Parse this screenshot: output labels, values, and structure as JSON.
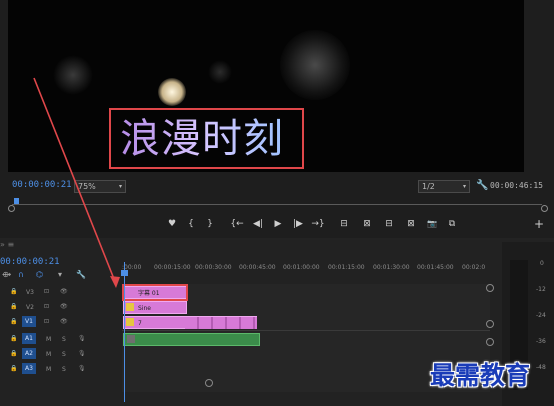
{
  "monitor": {
    "title_text": "浪漫时刻",
    "current_timecode": "00:00:00:21",
    "zoom": "75%",
    "resolution": "1/2",
    "duration": "00:00:46:15"
  },
  "controls": {
    "marker": "♥",
    "in": "{",
    "out": "}",
    "goto_in": "{←",
    "step_back": "◀|",
    "play": "▶",
    "step_fwd": "|▶",
    "goto_out": "→}",
    "lift": "⊟",
    "extract": "⊠",
    "camera": "📷",
    "add": "+"
  },
  "timeline": {
    "timecode": "00:00:00:21",
    "ruler": [
      ":00:00",
      "00:00:15:00",
      "00:00:30:00",
      "00:00:45:00",
      "00:01:00:00",
      "00:01:15:00",
      "00:01:30:00",
      "00:01:45:00",
      "00:02:0"
    ],
    "tracks": [
      {
        "id": "V3",
        "label": "V3"
      },
      {
        "id": "V2",
        "label": "V2"
      },
      {
        "id": "V1",
        "label": "V1"
      },
      {
        "id": "A1",
        "label": "A1",
        "m": "M",
        "s": "S"
      },
      {
        "id": "A2",
        "label": "A2",
        "m": "M",
        "s": "S"
      },
      {
        "id": "A3",
        "label": "A3",
        "m": "M",
        "s": "S"
      }
    ],
    "clips": {
      "v3": "字幕 01",
      "v2": "Sine",
      "v1": "7",
      "v1_sub": [
        "",
        ""
      ]
    },
    "meter_labels": [
      "0",
      "-12",
      "-24",
      "-36",
      "-48"
    ]
  },
  "watermark": "最需教育",
  "colors": {
    "accent_blue": "#4d8fe6",
    "highlight_red": "#e0474a",
    "clip_pink": "#d77ad7",
    "clip_green": "#3b8c4a"
  }
}
